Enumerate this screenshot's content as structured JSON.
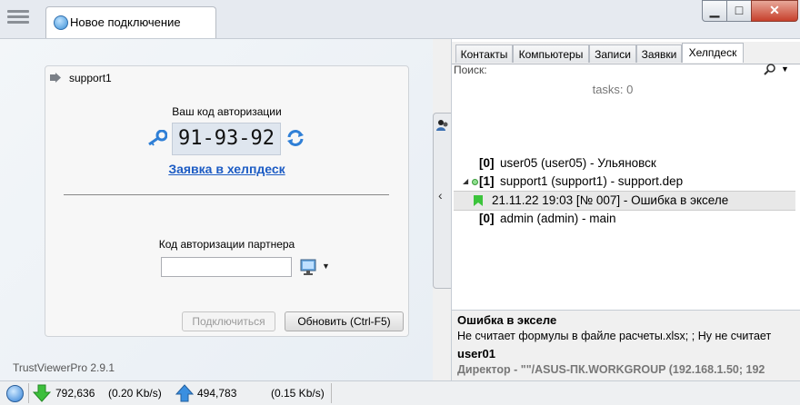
{
  "tab": {
    "title": "Новое подключение"
  },
  "card": {
    "user": "support1",
    "auth_title": "Ваш код авторизации",
    "auth_code": "91-93-92",
    "helpdesk_link": "Заявка в хелпдеск",
    "partner_label": "Код авторизации партнера",
    "partner_value": "",
    "connect_label": "Подключиться",
    "update_label": "Обновить (Ctrl-F5)"
  },
  "version": "TrustViewerPro 2.9.1",
  "right": {
    "tabs": [
      "Контакты",
      "Компьютеры",
      "Записи",
      "Заявки",
      "Хелпдеск"
    ],
    "active_tab": "Хелпдеск",
    "search_label": "Поиск:",
    "tasks": "tasks: 0",
    "items": [
      {
        "index": "[0]",
        "text": "user05 (user05) - Ульяновск"
      },
      {
        "index": "[1]",
        "text": "support1 (support1) - support.dep"
      },
      {
        "text": "21.11.22 19:03  [№ 007] - Ошибка в экселе"
      },
      {
        "index": "[0]",
        "text": "admin (admin) - main"
      }
    ],
    "details": {
      "title": "Ошибка в экселе",
      "description": "Не считает формулы в файле расчеты.xlsx; ; Ну не считает",
      "user": "user01",
      "info": "Директор - \"\"/ASUS-ПК.WORKGROUP (192.168.1.50; 192"
    }
  },
  "status": {
    "download": "792,636",
    "download_rate": "(0.20 Kb/s)",
    "upload": "494,783",
    "upload_rate": "(0.15 Kb/s)"
  },
  "colors": {
    "link": "#1d5cc4",
    "flag": "#3cc43c",
    "code_bg": "#dfe6ef"
  }
}
